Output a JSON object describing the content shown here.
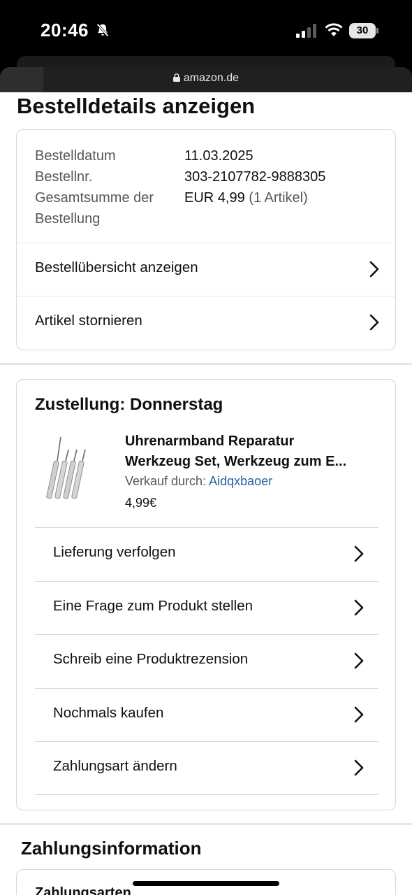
{
  "status_bar": {
    "time": "20:46",
    "battery": "30"
  },
  "browser": {
    "url": "amazon.de"
  },
  "page": {
    "title": "Bestelldetails anzeigen"
  },
  "order_summary": {
    "rows": [
      {
        "key": "Bestelldatum",
        "value": "11.03.2025"
      },
      {
        "key": "Bestellnr.",
        "value": "303-2107782-9888305"
      },
      {
        "key": "Gesamtsumme der Bestellung",
        "value": "EUR 4,99",
        "note": "(1 Artikel)"
      }
    ],
    "links": [
      "Bestellübersicht anzeigen",
      "Artikel stornieren"
    ]
  },
  "delivery": {
    "title": "Zustellung: Donnerstag",
    "product": {
      "title_line1": "Uhrenarmband Reparatur",
      "title_line2": "Werkzeug Set, Werkzeug zum E...",
      "seller_label": "Verkauf durch:",
      "seller": "Aidqxbaoer",
      "price": "4,99€"
    },
    "actions": [
      "Lieferung verfolgen",
      "Eine Frage zum Produkt stellen",
      "Schreib eine Produktrezension",
      "Nochmals kaufen",
      "Zahlungsart ändern"
    ]
  },
  "payment": {
    "title": "Zahlungsinformation",
    "first_row": "Zahlungsarten"
  },
  "colors": {
    "link": "#2162a1",
    "text": "#0f1111",
    "muted": "#565959",
    "border": "#d5d9d9"
  }
}
